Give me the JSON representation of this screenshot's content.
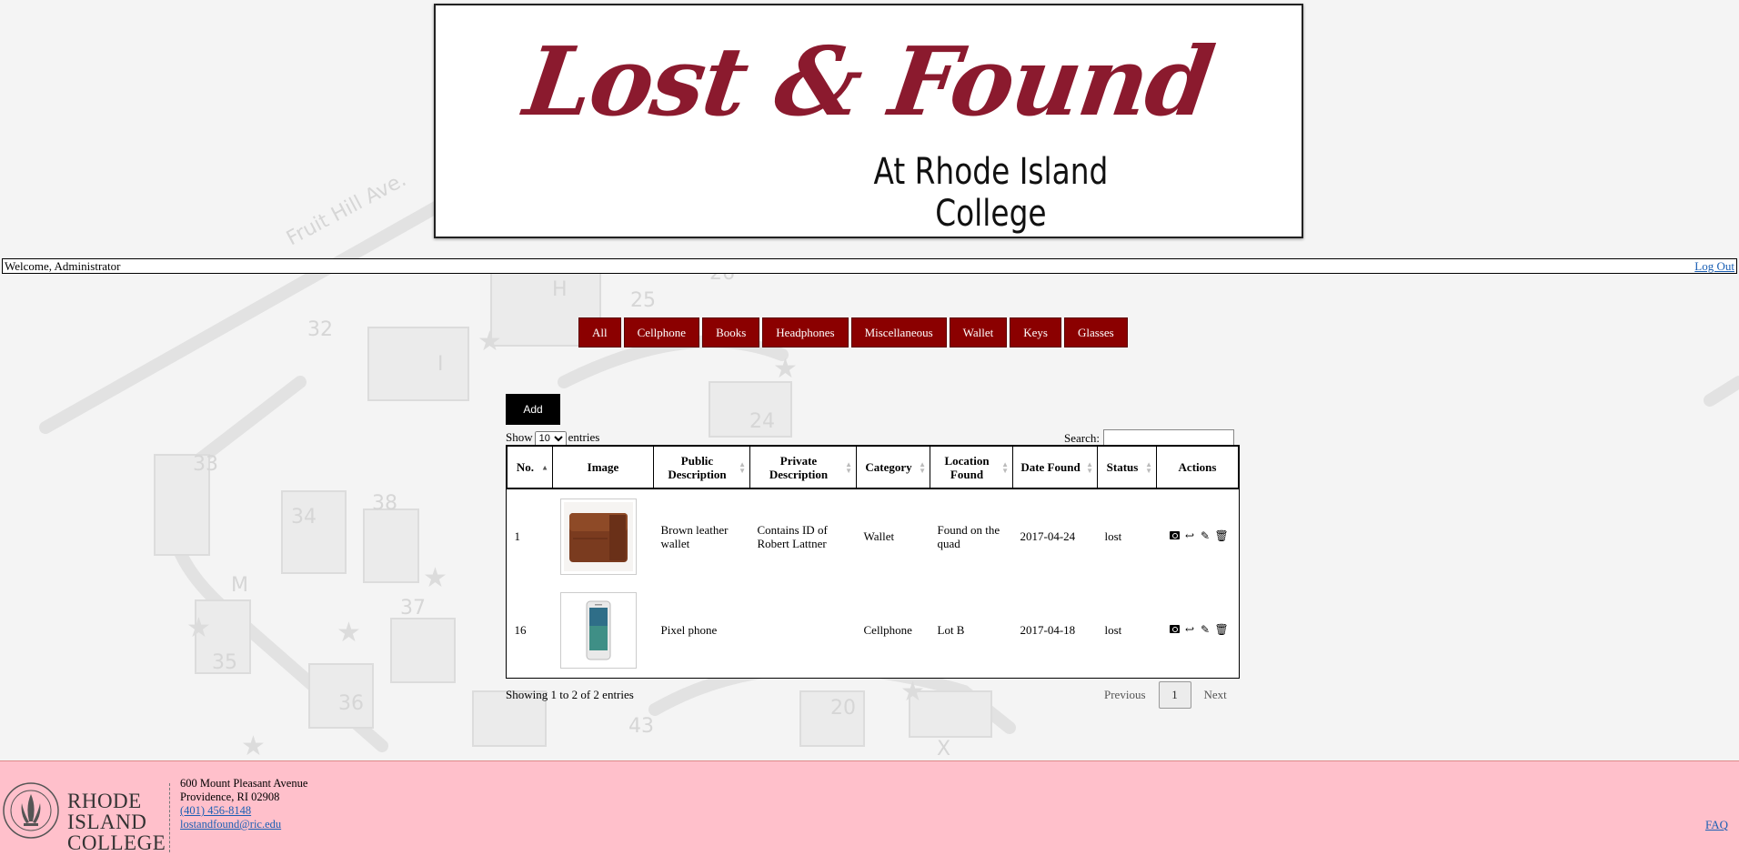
{
  "banner": {
    "title": "Lost & Found",
    "subtitle": "At Rhode Island College",
    "title_color": "#8b1a2e"
  },
  "map_labels": [
    "Fruit Hill Ave.",
    "25",
    "26",
    "H",
    "32",
    "I",
    "24",
    "33",
    "34",
    "38",
    "M",
    "35",
    "36",
    "37",
    "20",
    "43",
    "X"
  ],
  "header": {
    "welcome": "Welcome, Administrator",
    "logout": "Log Out"
  },
  "categories": [
    "All",
    "Cellphone",
    "Books",
    "Headphones",
    "Miscellaneous",
    "Wallet",
    "Keys",
    "Glasses"
  ],
  "category_color": "#8b0000",
  "add_label": "Add",
  "table_controls": {
    "show_label": "Show",
    "page_size": "10",
    "entries_label": "entries",
    "search_label": "Search:",
    "search_value": ""
  },
  "columns": [
    "No.",
    "Image",
    "Public Description",
    "Private Description",
    "Category",
    "Location Found",
    "Date Found",
    "Status",
    "Actions"
  ],
  "rows": [
    {
      "no": "1",
      "image": "wallet-photo",
      "public": "Brown leather wallet",
      "private": "Contains ID of Robert Lattner",
      "category": "Wallet",
      "location": "Found on the quad",
      "date": "2017-04-24",
      "status": "lost"
    },
    {
      "no": "16",
      "image": "phone-photo",
      "public": "Pixel phone",
      "private": "",
      "category": "Cellphone",
      "location": "Lot B",
      "date": "2017-04-18",
      "status": "lost"
    }
  ],
  "action_icons": [
    "search-icon",
    "return-icon",
    "edit-icon",
    "trash-icon"
  ],
  "pagination": {
    "info": "Showing 1 to 2 of 2 entries",
    "previous": "Previous",
    "current": "1",
    "next": "Next"
  },
  "footer": {
    "college_line1": "RHODE",
    "college_line2": "ISLAND",
    "college_line3": "COLLEGE",
    "address1": "600 Mount Pleasant Avenue",
    "address2": "Providence, RI 02908",
    "phone": "(401) 456-8148",
    "email": "lostandfound@ric.edu",
    "faq": "FAQ",
    "background": "#ffc0cb"
  }
}
